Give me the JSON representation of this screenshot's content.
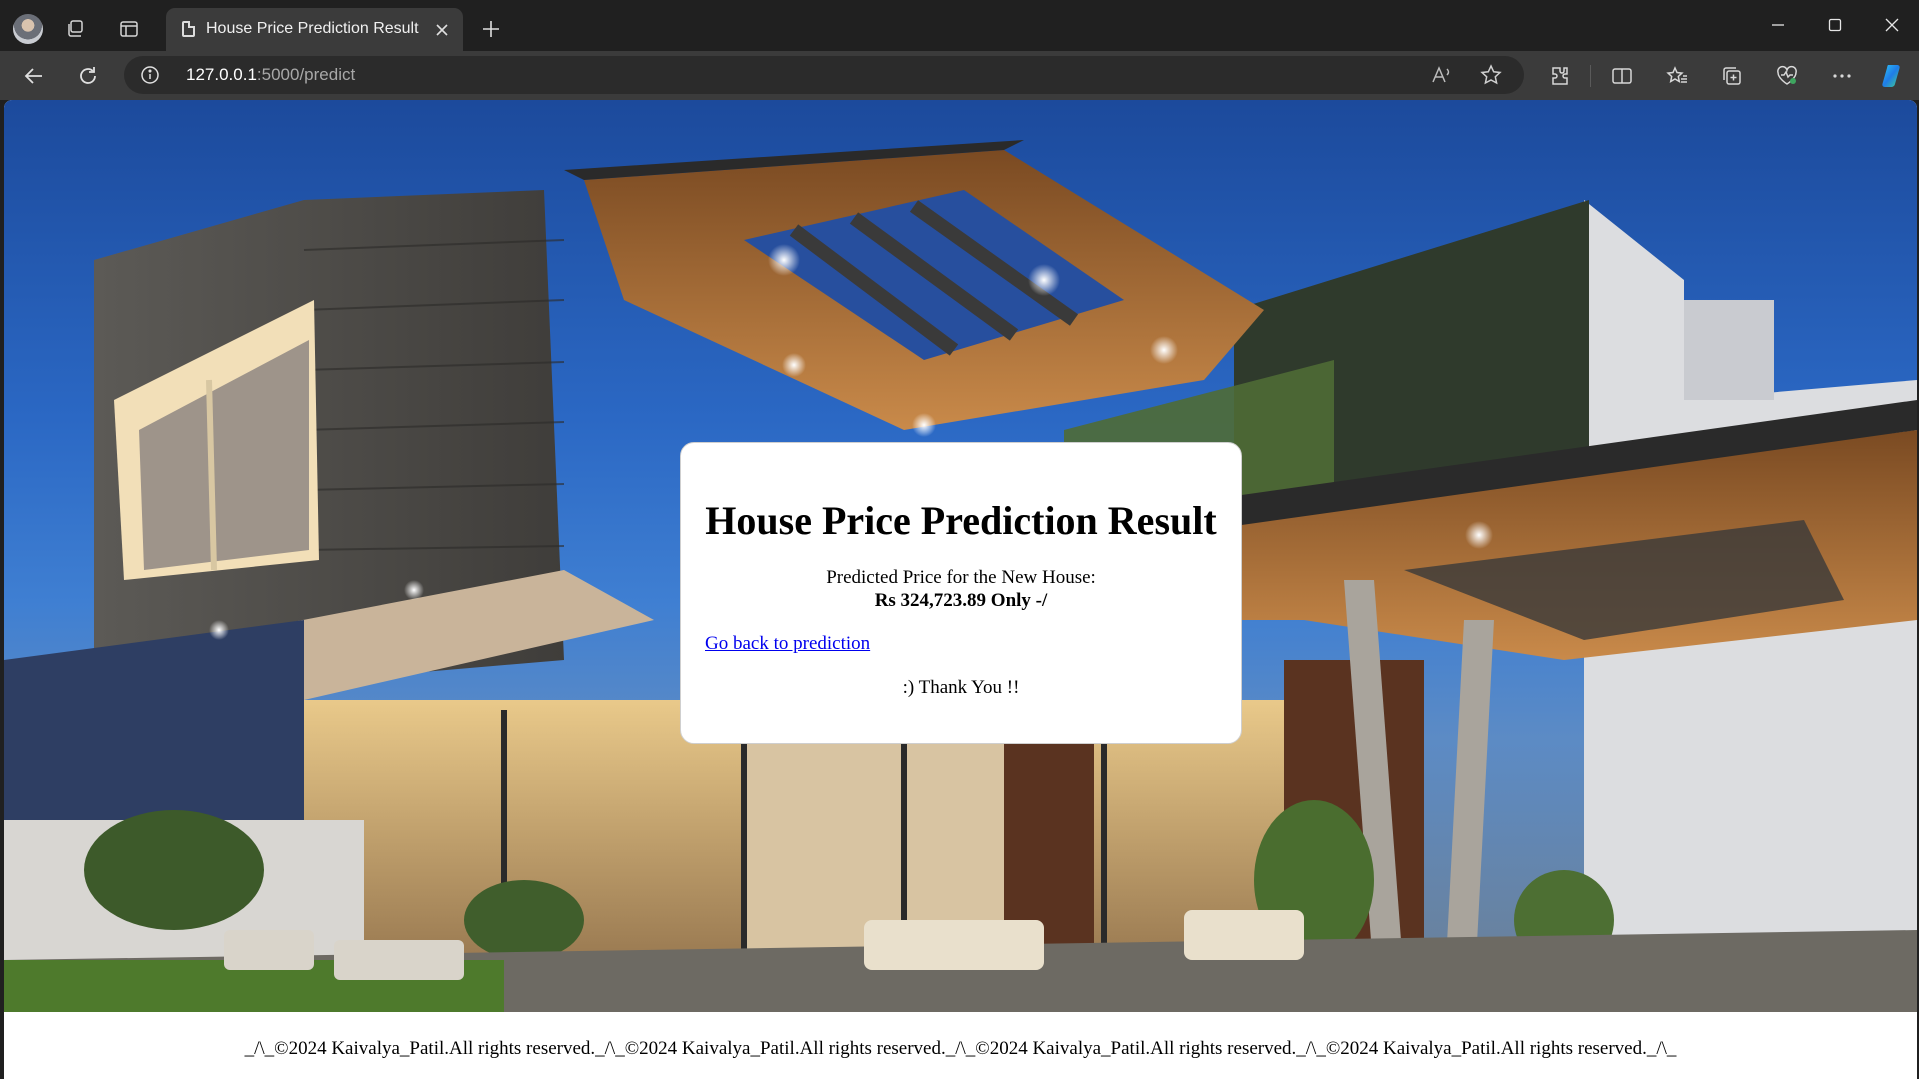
{
  "browser": {
    "tab_title": "House Price Prediction Result",
    "url_host": "127.0.0.1",
    "url_rest": ":5000/predict"
  },
  "card": {
    "title": "House Price Prediction Result",
    "label": "Predicted Price for the New House:",
    "price": "Rs 324,723.89 Only -/",
    "back_link": "Go back to prediction",
    "thanks": ":) Thank You !!"
  },
  "footer": {
    "text": "_/\\_©2024 Kaivalya_Patil.All rights reserved._/\\_©2024 Kaivalya_Patil.All rights reserved._/\\_©2024 Kaivalya_Patil.All rights reserved._/\\_©2024 Kaivalya_Patil.All rights reserved._/\\_"
  },
  "icons": [
    "profile-avatar",
    "workspaces-icon",
    "tab-actions-icon",
    "page-icon",
    "close-icon",
    "plus-icon",
    "minimize-icon",
    "maximize-icon",
    "window-close-icon",
    "back-arrow-icon",
    "refresh-icon",
    "info-icon",
    "read-aloud-icon",
    "favorite-star-icon",
    "extensions-icon",
    "split-screen-icon",
    "favorites-icon",
    "collections-icon",
    "browser-essentials-icon",
    "more-icon",
    "copilot-icon"
  ]
}
